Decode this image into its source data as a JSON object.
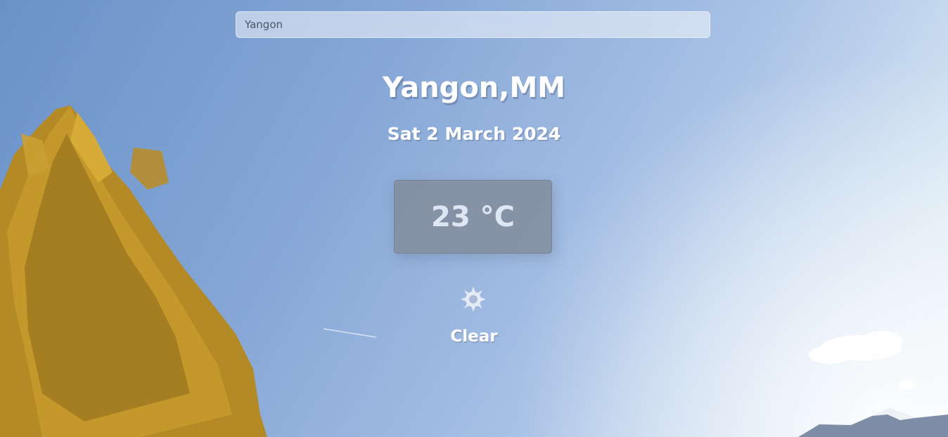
{
  "search": {
    "value": "Yangon",
    "placeholder": ""
  },
  "weather": {
    "location": "Yangon,MM",
    "date": "Sat 2 March 2024",
    "temperature": "23 °C",
    "icon": "sun-icon",
    "condition": "Clear"
  },
  "colors": {
    "sky_top": "#6a92c8",
    "sky_bottom": "#eef5f8",
    "temp_box": "#8c96a3",
    "text": "#ffffff"
  }
}
